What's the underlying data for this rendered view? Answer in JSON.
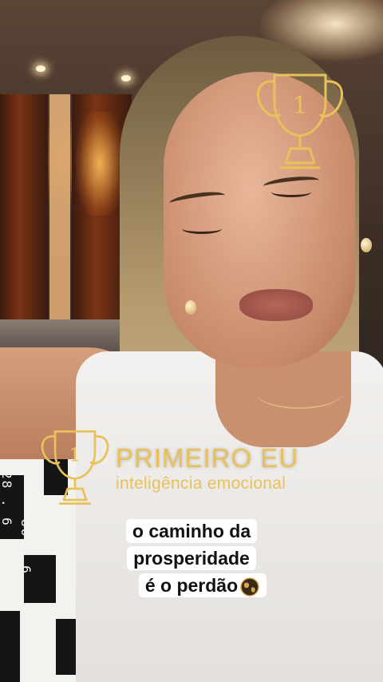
{
  "overlay": {
    "brand_title": "PRIMEIRO EU",
    "brand_subtitle": "inteligência emocional",
    "trophy_number": "1"
  },
  "caption": {
    "line1": "o caminho da",
    "line2": "prosperidade",
    "line3": "é o perdão",
    "emoji": "globe-icon"
  },
  "sleeve_print": {
    "text1": "28 . 6 . 82",
    "text2": "86 . 6 . 82"
  },
  "colors": {
    "brand_gold": "#e8c15a",
    "caption_bg": "#ffffff",
    "caption_text": "#111111"
  }
}
